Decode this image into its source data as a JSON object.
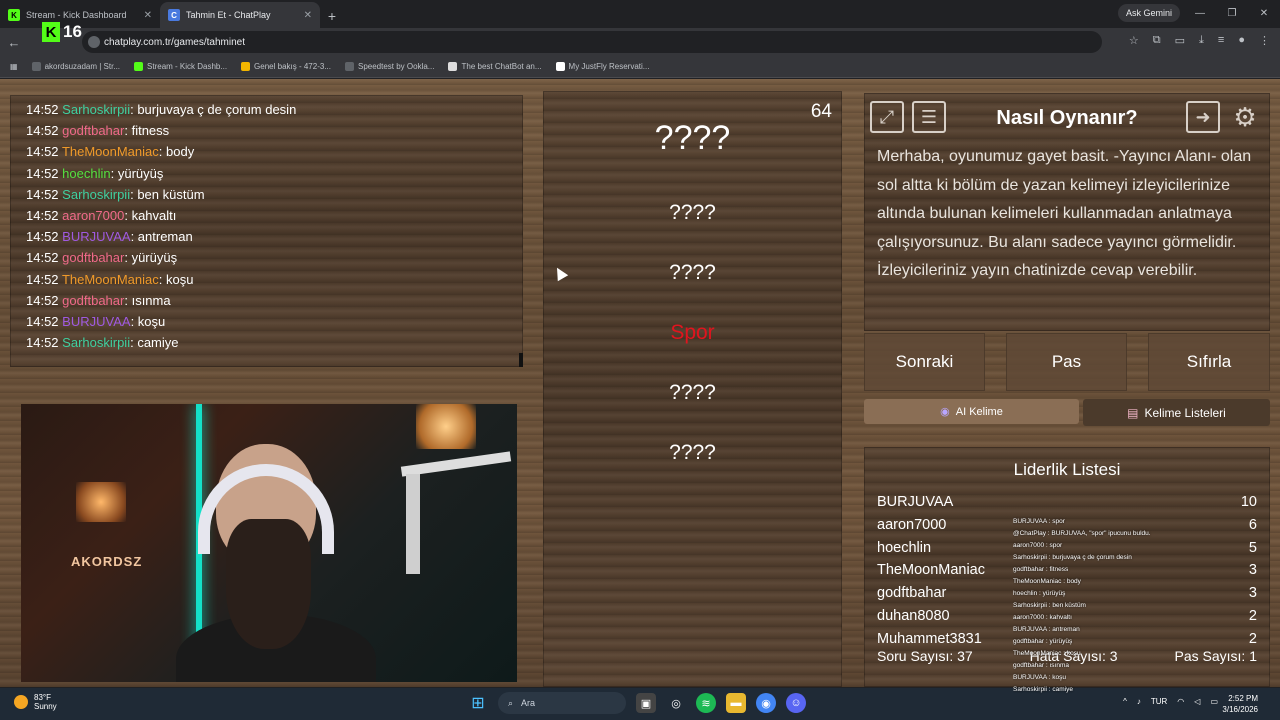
{
  "browser": {
    "tabs": [
      {
        "label": "Stream - Kick Dashboard",
        "active": false
      },
      {
        "label": "Tahmin Et - ChatPlay",
        "active": true
      }
    ],
    "ask_gemini": "Ask Gemini",
    "url": "chatplay.com.tr/games/tahminet",
    "overlay_badge": "16",
    "bookmarks": [
      "akordsuzadam | Str...",
      "Stream - Kick Dashb...",
      "Genel bakış - 472-3...",
      "Speedtest by Ookla...",
      "The best ChatBot an...",
      "My JustFly Reservati..."
    ]
  },
  "chat": {
    "lines": [
      {
        "time": "14:52",
        "user": "Sarhoskirpii",
        "color": "#3fd0a0",
        "msg": "burjuvaya ç de çorum desin"
      },
      {
        "time": "14:52",
        "user": "godftbahar",
        "color": "#f06a8a",
        "msg": "fitness"
      },
      {
        "time": "14:52",
        "user": "TheMoonManiac",
        "color": "#f09a2a",
        "msg": "body"
      },
      {
        "time": "14:52",
        "user": "hoechlin",
        "color": "#55e040",
        "msg": "yürüyüş"
      },
      {
        "time": "14:52",
        "user": "Sarhoskirpii",
        "color": "#3fd0a0",
        "msg": "ben küstüm"
      },
      {
        "time": "14:52",
        "user": "aaron7000",
        "color": "#f06a8a",
        "msg": "kahvaltı"
      },
      {
        "time": "14:52",
        "user": "BURJUVAA",
        "color": "#a05ae0",
        "msg": "antreman"
      },
      {
        "time": "14:52",
        "user": "godftbahar",
        "color": "#f06a8a",
        "msg": "yürüyüş"
      },
      {
        "time": "14:52",
        "user": "TheMoonManiac",
        "color": "#f09a2a",
        "msg": "koşu"
      },
      {
        "time": "14:52",
        "user": "godftbahar",
        "color": "#f06a8a",
        "msg": "ısınma"
      },
      {
        "time": "14:52",
        "user": "BURJUVAA",
        "color": "#a05ae0",
        "msg": "koşu"
      },
      {
        "time": "14:52",
        "user": "Sarhoskirpii",
        "color": "#3fd0a0",
        "msg": "camiye"
      }
    ]
  },
  "webcam": {
    "sign_text": "AKORDSZ"
  },
  "words": {
    "counter": "64",
    "items": [
      {
        "text": "????",
        "style": "big"
      },
      {
        "text": "????",
        "style": "normal"
      },
      {
        "text": "????",
        "style": "normal"
      },
      {
        "text": "Spor",
        "style": "red"
      },
      {
        "text": "????",
        "style": "normal"
      },
      {
        "text": "????",
        "style": "normal"
      }
    ]
  },
  "howto": {
    "title": "Nasıl Oynanır?",
    "text": "Merhaba, oyunumuz gayet basit. -Yayıncı Alanı- olan sol altta ki bölüm de yazan kelimeyi izleyicilerinize altında bulunan kelimeleri kullanmadan anlatmaya çalışıyorsunuz. Bu alanı sadece yayıncı görmelidir. İzleyicileriniz yayın chatinizde cevap verebilir."
  },
  "controls": {
    "next": "Sonraki",
    "pass": "Pas",
    "reset": "Sıfırla",
    "ai_word": "AI Kelime",
    "word_lists": "Kelime Listeleri"
  },
  "leaderboard": {
    "title": "Liderlik Listesi",
    "rows": [
      {
        "name": "BURJUVAA",
        "score": "10"
      },
      {
        "name": "aaron7000",
        "score": "6"
      },
      {
        "name": "hoechlin",
        "score": "5"
      },
      {
        "name": "TheMoonManiac",
        "score": "3"
      },
      {
        "name": "godftbahar",
        "score": "3"
      },
      {
        "name": "duhan8080",
        "score": "2"
      },
      {
        "name": "Muhammet3831",
        "score": "2"
      }
    ],
    "question_count": "Soru Sayısı: 37",
    "error_count": "Hata Sayısı: 3",
    "pass_count": "Pas Sayısı: 1"
  },
  "stream_chat_overlay": [
    "BURJUVAA : spor",
    "@ChatPlay : BURJUVAA, \"spor\" ipucunu buldu.",
    "aaron7000 : spor",
    "Sarhoskirpii : burjuvaya ç de çorum desin",
    "godftbahar : fitness",
    "TheMoonManiac : body",
    "hoechlin : yürüyüş",
    "Sarhoskirpii : ben küstüm",
    "aaron7000 : kahvaltı",
    "BURJUVAA : antreman",
    "godftbahar : yürüyüş",
    "TheMoonManiac : koşu",
    "godftbahar : ısınma",
    "BURJUVAA : koşu",
    "Sarhoskirpii : camiye"
  ],
  "taskbar": {
    "temp": "83°F",
    "weather": "Sunny",
    "search": "Ara",
    "lang": "TUR",
    "time": "2:52 PM",
    "date": "3/16/2026"
  }
}
